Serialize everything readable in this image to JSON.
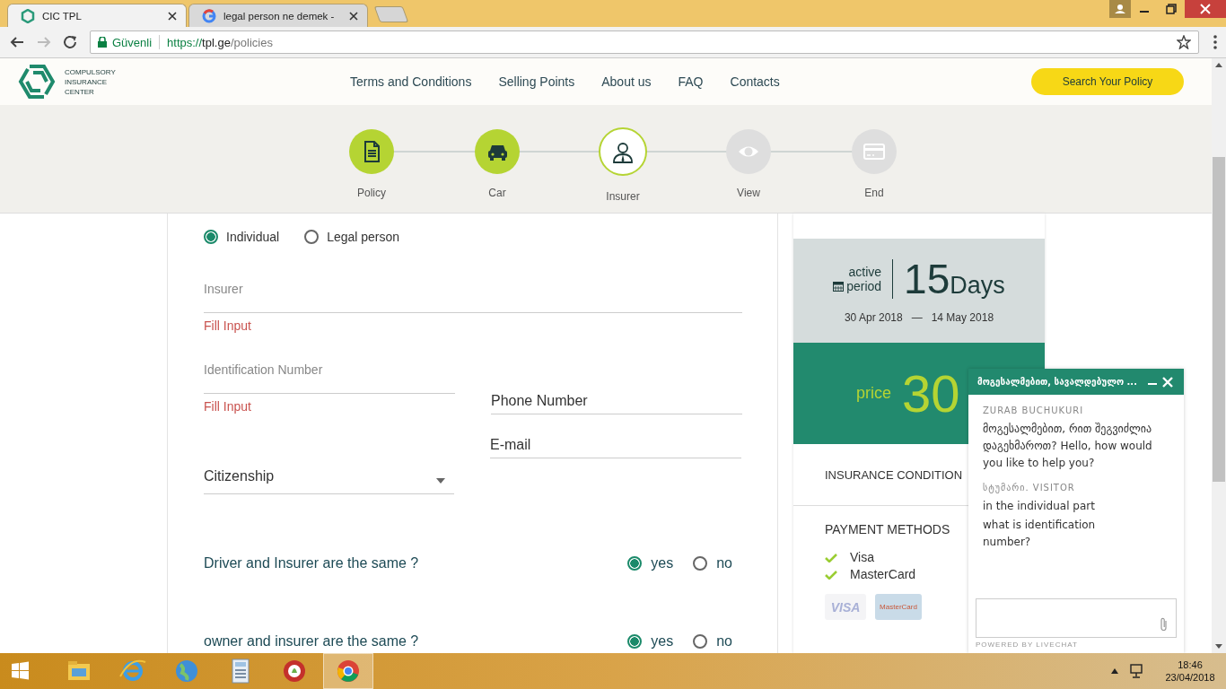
{
  "browser": {
    "tabs": [
      {
        "title": "CIC TPL",
        "selected": true,
        "kind": "cic"
      },
      {
        "title": "legal person ne demek -",
        "selected": false,
        "kind": "google"
      }
    ],
    "address": {
      "secure_label": "Güvenli",
      "scheme": "https://",
      "host": "tpl.ge",
      "path": "/policies"
    }
  },
  "header": {
    "logo_lines": [
      "COMPULSORY",
      "INSURANCE",
      "CENTER"
    ],
    "nav": [
      "Terms and Conditions",
      "Selling Points",
      "About us",
      "FAQ",
      "Contacts"
    ],
    "search_button": "Search Your Policy"
  },
  "steps": [
    {
      "label": "Policy",
      "completed": true,
      "selected": false,
      "kind": "document"
    },
    {
      "label": "Car",
      "completed": true,
      "selected": false,
      "kind": "car"
    },
    {
      "label": "Insurer",
      "completed": false,
      "selected": true,
      "kind": "person"
    },
    {
      "label": "View",
      "completed": false,
      "selected": false,
      "kind": "eye"
    },
    {
      "label": "End",
      "completed": false,
      "selected": false,
      "kind": "card"
    }
  ],
  "form": {
    "person_type": [
      {
        "label": "Individual",
        "selected": true
      },
      {
        "label": "Legal person",
        "selected": false
      }
    ],
    "insurer": {
      "placeholder": "Insurer",
      "error": "Fill Input"
    },
    "identification": {
      "placeholder": "Identification Number",
      "error": "Fill Input"
    },
    "phone": {
      "placeholder": "Phone Number"
    },
    "citizenship": {
      "placeholder": "Citizenship"
    },
    "email": {
      "placeholder": "E-mail"
    },
    "questions": [
      {
        "text": "Driver and Insurer are the same ?",
        "options": [
          {
            "label": "yes",
            "selected": true
          },
          {
            "label": "no",
            "selected": false
          }
        ]
      },
      {
        "text": "owner and insurer are the same ?",
        "options": [
          {
            "label": "yes",
            "selected": true
          },
          {
            "label": "no",
            "selected": false
          }
        ]
      }
    ]
  },
  "summary": {
    "active_lines": [
      "active",
      "period"
    ],
    "days": "15",
    "days_unit": "Days",
    "start": "30 Apr 2018",
    "separator": "—",
    "end": "14 May 2018",
    "price_label": "price",
    "price": "30",
    "conditions": "INSURANCE CONDITION",
    "payment_title": "PAYMENT METHODS",
    "payment_methods": [
      "Visa",
      "MasterCard"
    ],
    "card_logos": [
      {
        "kind": "visa",
        "text": "VISA"
      },
      {
        "kind": "mastercard",
        "text": "MasterCard"
      }
    ]
  },
  "chat": {
    "title": "მოგესალმებით, სავალდებულო ...",
    "messages": [
      {
        "author": "ZURAB BUCHUKURI",
        "lines": [
          "მოგესალმებით, რით შეგვიძლია დაგეხმაროთ? Hello, how would you like to help you?"
        ]
      },
      {
        "author": "სტუმარი. VISITOR",
        "lines": [
          "in the individual part",
          "what is identification number?"
        ]
      }
    ],
    "footer": "POWERED BY LIVECHAT"
  },
  "taskbar": {
    "apps": [
      {
        "kind": "explorer",
        "selected": false
      },
      {
        "kind": "ie",
        "selected": false
      },
      {
        "kind": "globe",
        "selected": false
      },
      {
        "kind": "calculator",
        "selected": false
      },
      {
        "kind": "red-app",
        "selected": false
      },
      {
        "kind": "chrome",
        "selected": true
      }
    ],
    "time": "18:46",
    "date": "23/04/2018"
  }
}
